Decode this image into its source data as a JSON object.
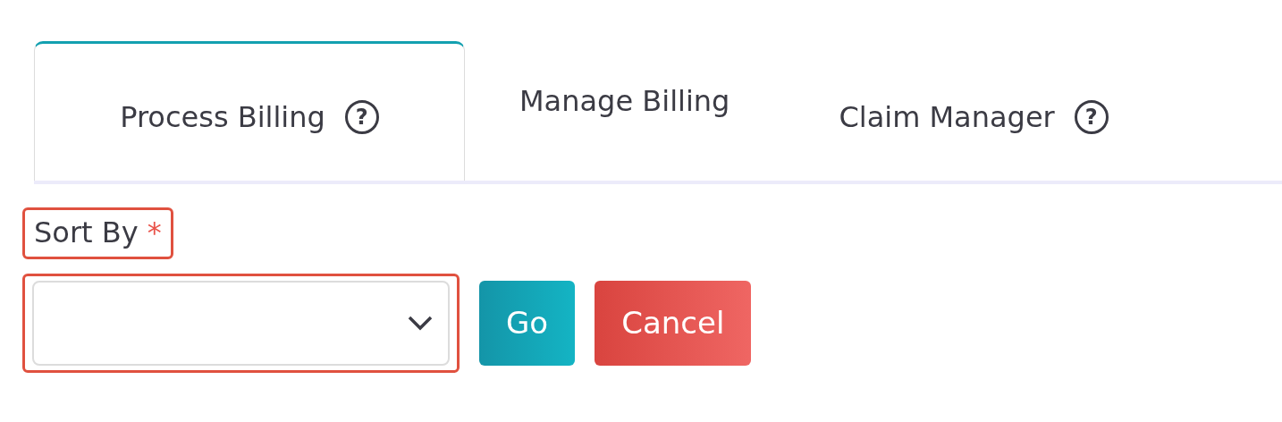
{
  "tabs": [
    {
      "label": "Process Billing",
      "selected": true,
      "help": "?"
    },
    {
      "label": "Manage Billing",
      "selected": false
    },
    {
      "label": "Claim Manager",
      "selected": false,
      "help": "?"
    }
  ],
  "sort_by": {
    "label": "Sort By",
    "required_mark": "*",
    "highlighted": true
  },
  "sort_select": {
    "highlighted": true
  },
  "buttons": [
    {
      "label": "Go",
      "kind": "primary"
    },
    {
      "label": "Cancel",
      "kind": "danger"
    }
  ]
}
